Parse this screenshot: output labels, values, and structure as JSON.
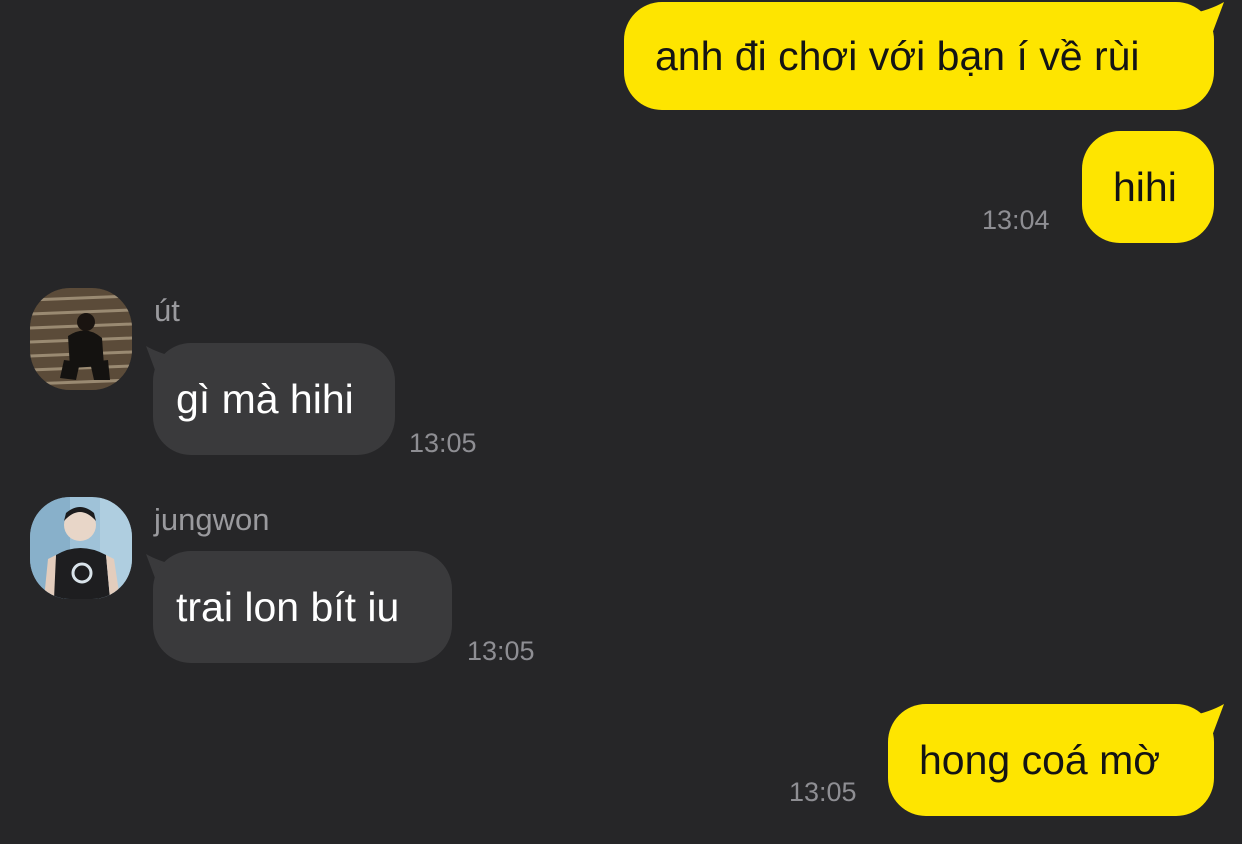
{
  "colors": {
    "background": "#262628",
    "outgoing_bubble": "#FEE500",
    "incoming_bubble": "#3A3A3C",
    "timestamp": "#8E8E93",
    "sender_name": "#9A9A9E"
  },
  "messages": [
    {
      "direction": "outgoing",
      "text": "anh đi chơi với bạn í về rùi",
      "time": ""
    },
    {
      "direction": "outgoing",
      "text": "hihi",
      "time": "13:04"
    },
    {
      "direction": "incoming",
      "sender": "út",
      "avatar": "avatar-photo-stairs",
      "text": "gì mà hihi",
      "time": "13:05"
    },
    {
      "direction": "incoming",
      "sender": "jungwon",
      "avatar": "avatar-photo-portrait",
      "text": "trai lon bít iu",
      "time": "13:05"
    },
    {
      "direction": "outgoing",
      "text": "hong coá mờ",
      "time": "13:05"
    }
  ]
}
